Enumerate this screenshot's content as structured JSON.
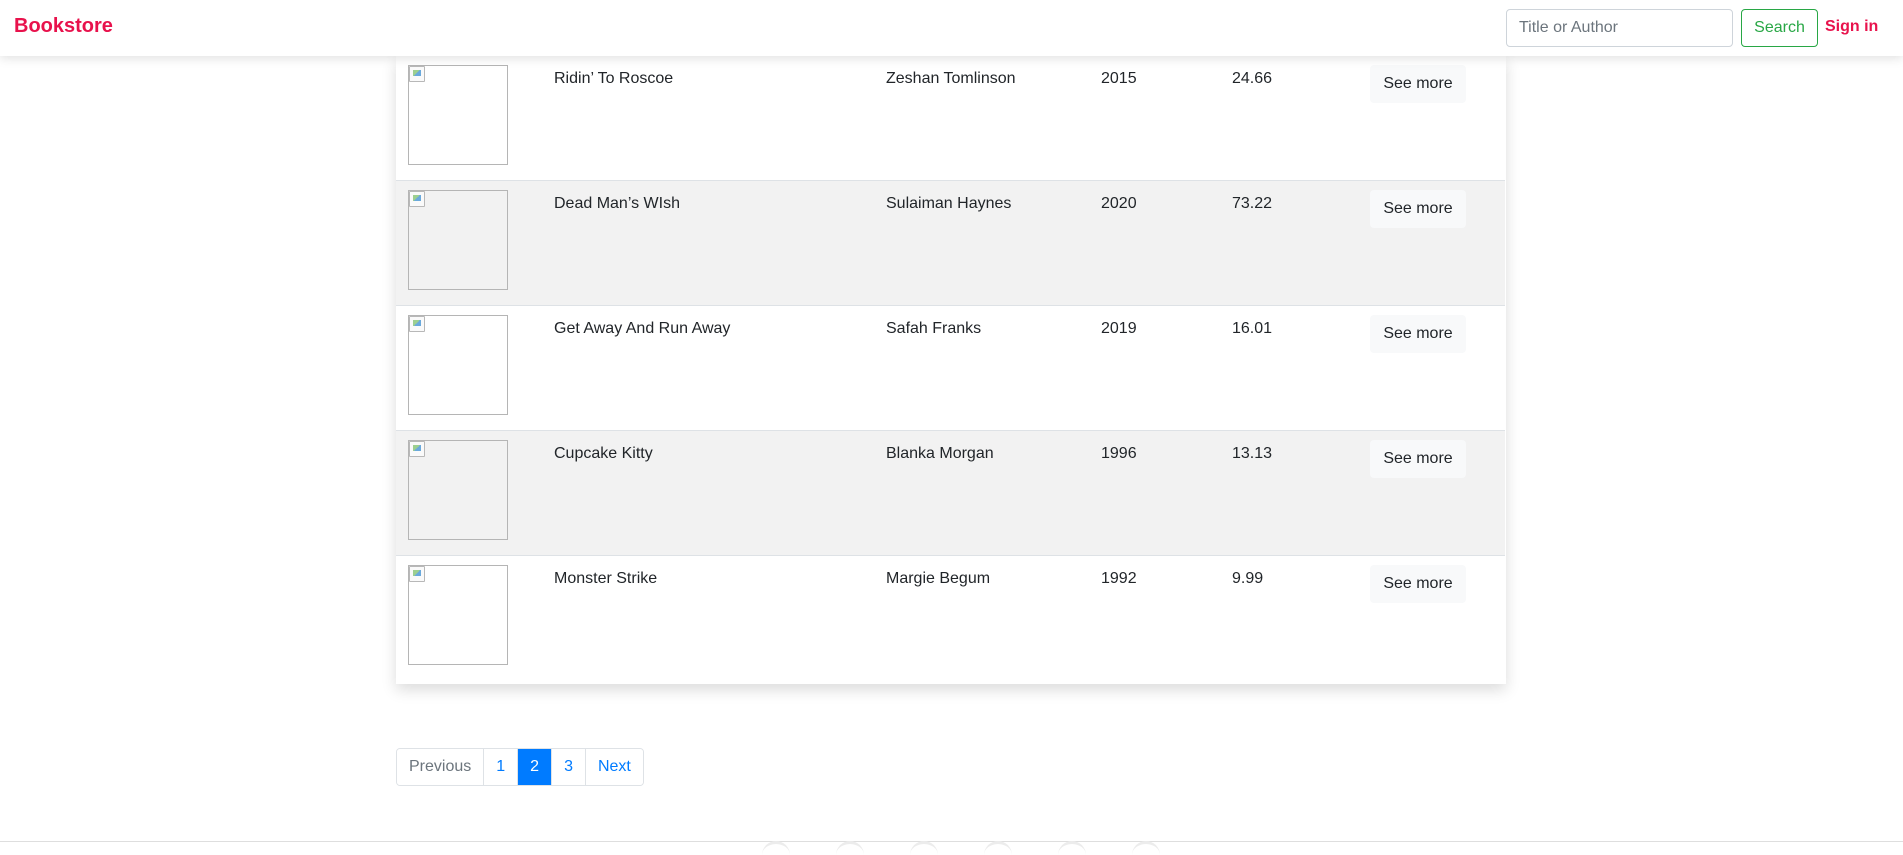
{
  "navbar": {
    "brand": "Bookstore",
    "search_placeholder": "Title or Author",
    "search_button": "Search",
    "sign_in": "Sign in"
  },
  "books": [
    {
      "title": "Ridin’ To Roscoe",
      "author": "Zeshan Tomlinson",
      "year": "2015",
      "price": "24.66",
      "action": "See more"
    },
    {
      "title": "Dead Man’s WIsh",
      "author": "Sulaiman Haynes",
      "year": "2020",
      "price": "73.22",
      "action": "See more"
    },
    {
      "title": "Get Away And Run Away",
      "author": "Safah Franks",
      "year": "2019",
      "price": "16.01",
      "action": "See more"
    },
    {
      "title": "Cupcake Kitty",
      "author": "Blanka Morgan",
      "year": "1996",
      "price": "13.13",
      "action": "See more"
    },
    {
      "title": "Monster Strike",
      "author": "Margie Begum",
      "year": "1992",
      "price": "9.99",
      "action": "See more"
    }
  ],
  "pagination": {
    "previous": "Previous",
    "pages": [
      "1",
      "2",
      "3"
    ],
    "current": "2",
    "next": "Next"
  },
  "colors": {
    "brand": "#e8124c",
    "search_button": "#28a745",
    "link": "#007bff"
  }
}
